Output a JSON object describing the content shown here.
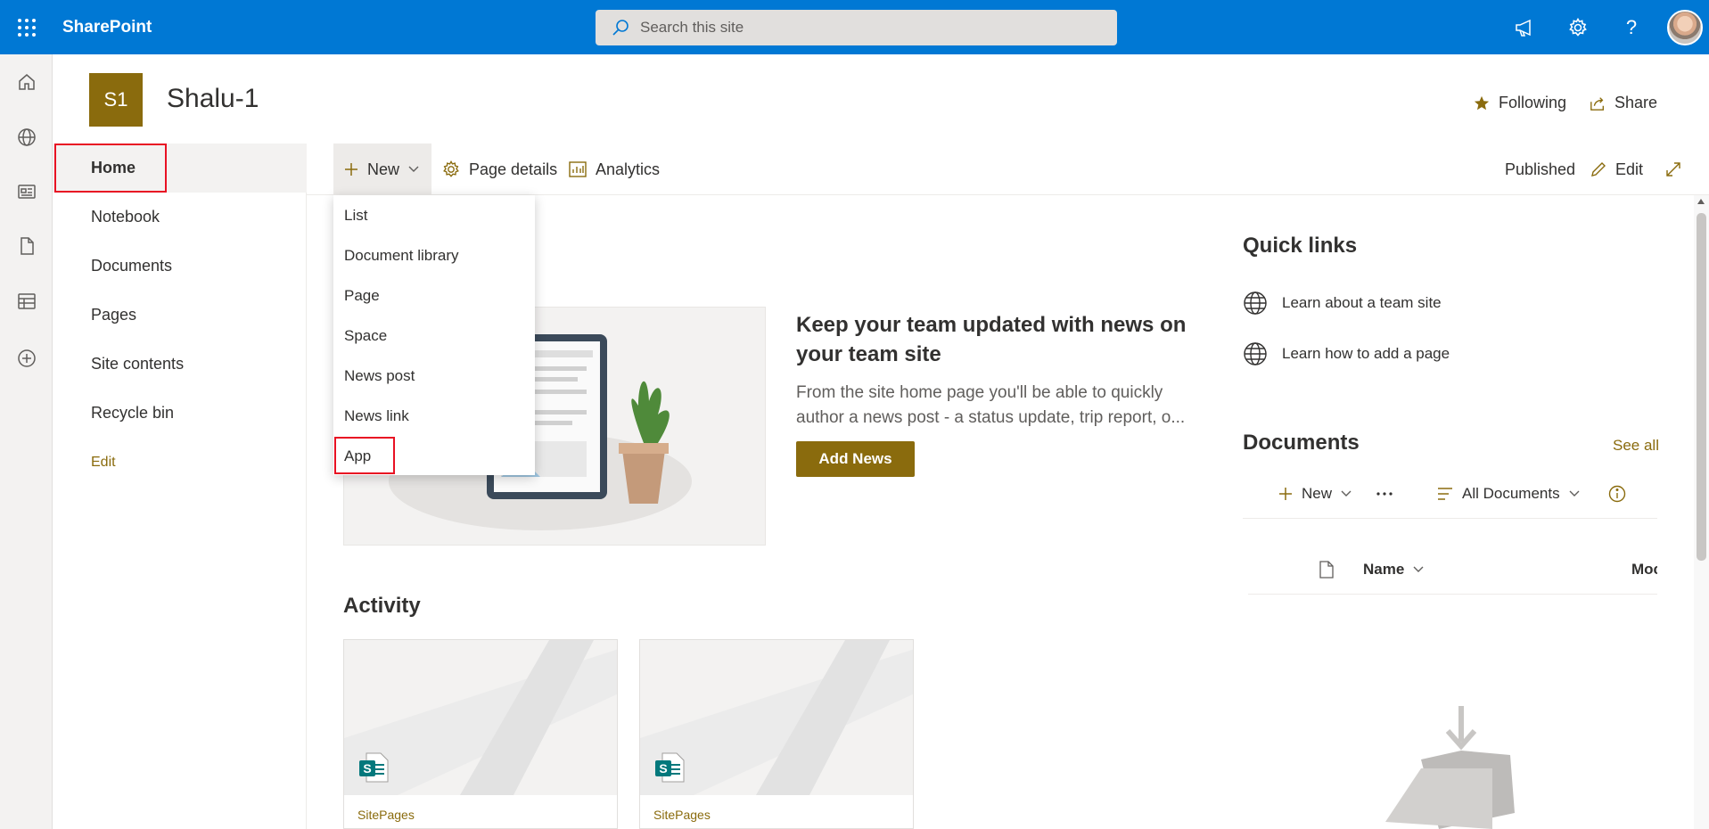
{
  "suite": {
    "brand": "SharePoint",
    "search_placeholder": "Search this site"
  },
  "site": {
    "logo_text": "S1",
    "title": "Shalu-1",
    "following_label": "Following",
    "share_label": "Share"
  },
  "leftnav": {
    "items": [
      {
        "label": "Home",
        "active": true
      },
      {
        "label": "Notebook"
      },
      {
        "label": "Documents"
      },
      {
        "label": "Pages"
      },
      {
        "label": "Site contents"
      },
      {
        "label": "Recycle bin"
      }
    ],
    "edit_label": "Edit"
  },
  "commandbar": {
    "new_label": "New",
    "page_details_label": "Page details",
    "analytics_label": "Analytics",
    "status": "Published",
    "edit_label": "Edit"
  },
  "new_menu": {
    "items": [
      "List",
      "Document library",
      "Page",
      "Space",
      "News post",
      "News link",
      "App"
    ]
  },
  "news": {
    "title": "Keep your team updated with news on your team site",
    "description": "From the site home page you'll be able to quickly author a news post - a status update, trip report, o...",
    "add_button": "Add News"
  },
  "activity": {
    "title": "Activity",
    "cards": [
      {
        "label": "SitePages"
      },
      {
        "label": "SitePages"
      }
    ]
  },
  "quick_links": {
    "title": "Quick links",
    "items": [
      "Learn about a team site",
      "Learn how to add a page"
    ]
  },
  "documents": {
    "title": "Documents",
    "see_all": "See all",
    "new_label": "New",
    "view_label": "All Documents",
    "col_name": "Name",
    "col_modified_partial": "Moc"
  },
  "colors": {
    "suitebar": "#0078d4",
    "site_accent": "#8a6b0d",
    "highlight_box": "#e81123"
  }
}
